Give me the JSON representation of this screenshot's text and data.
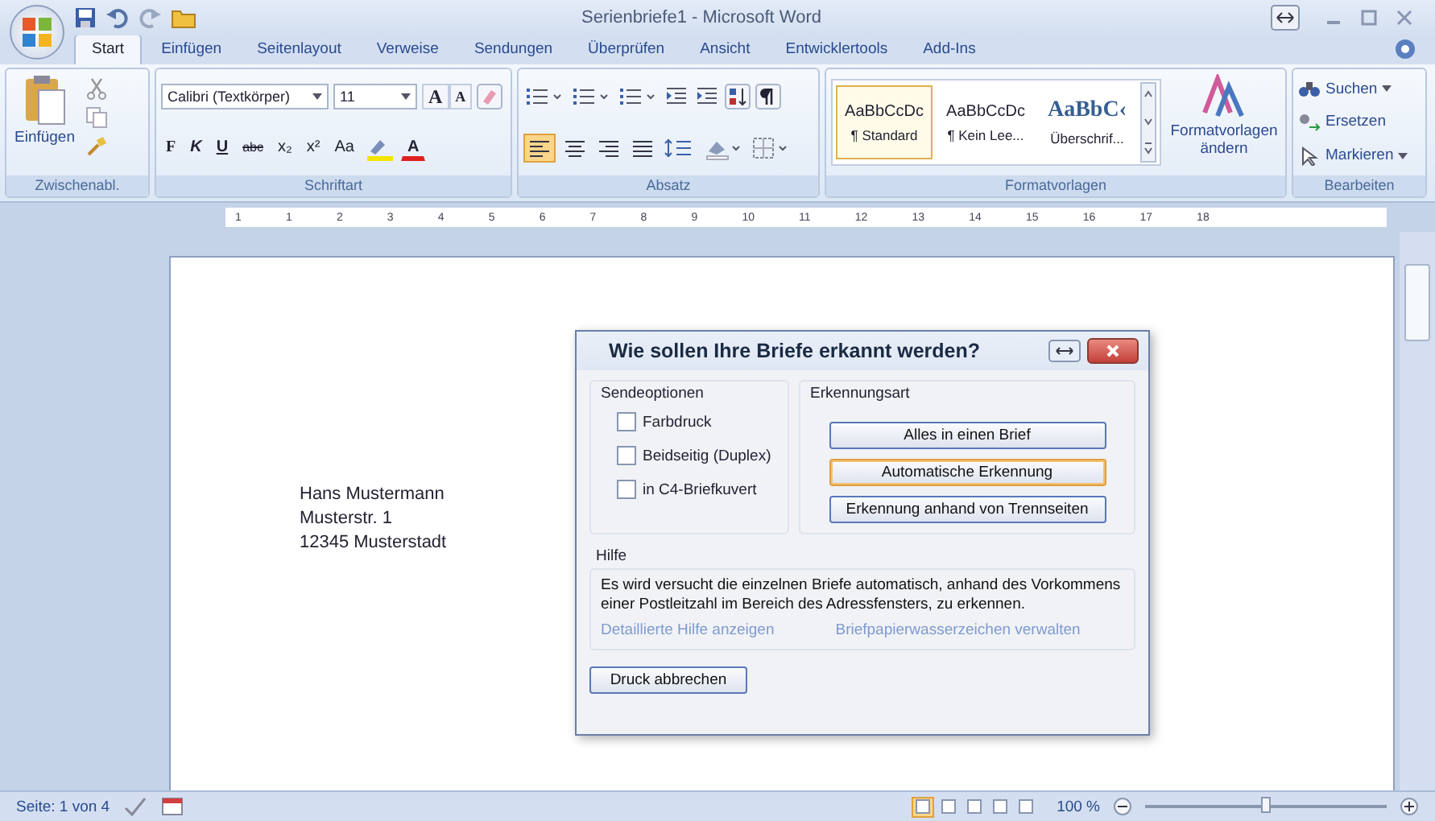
{
  "window": {
    "title": "Serienbriefe1 - Microsoft Word"
  },
  "tabs": [
    {
      "label": "Start",
      "selected": true
    },
    {
      "label": "Einfügen",
      "selected": false
    },
    {
      "label": "Seitenlayout",
      "selected": false
    },
    {
      "label": "Verweise",
      "selected": false
    },
    {
      "label": "Sendungen",
      "selected": false
    },
    {
      "label": "Überprüfen",
      "selected": false
    },
    {
      "label": "Ansicht",
      "selected": false
    },
    {
      "label": "Entwicklertools",
      "selected": false
    },
    {
      "label": "Add-Ins",
      "selected": false
    }
  ],
  "ribbon": {
    "clipboard": {
      "paste_label": "Einfügen",
      "group": "Zwischenabl."
    },
    "font": {
      "family": "Calibri (Textkörper)",
      "size": "11",
      "size_buttons": [
        "A",
        "A"
      ],
      "format_buttons": [
        "F",
        "K",
        "U",
        "abc",
        "x₂",
        "x²",
        "Aa"
      ],
      "color_button": "A",
      "group": "Schriftart"
    },
    "paragraph": {
      "group": "Absatz"
    },
    "styles": {
      "items": [
        {
          "kind": "body",
          "sample": "AaBbCcDc",
          "name": "¶ Standard",
          "selected": true
        },
        {
          "kind": "body",
          "sample": "AaBbCcDc",
          "name": "¶ Kein Lee...",
          "selected": false
        },
        {
          "kind": "heading",
          "sample": "AaBbC‹",
          "name": "Überschrif...",
          "selected": false
        }
      ],
      "change_label": "Formatvorlagen ändern",
      "group": "Formatvorlagen"
    },
    "editing": {
      "items": [
        "Suchen",
        "Ersetzen",
        "Markieren"
      ],
      "group": "Bearbeiten"
    }
  },
  "ruler": {
    "numbers": [
      "1",
      "1",
      "2",
      "3",
      "4",
      "5",
      "6",
      "7",
      "8",
      "9",
      "10",
      "11",
      "12",
      "13",
      "14",
      "15",
      "16",
      "17",
      "18"
    ]
  },
  "document": {
    "address": [
      "Hans Mustermann",
      "Musterstr. 1",
      "12345 Musterstadt"
    ]
  },
  "dialog": {
    "title": "Wie sollen Ihre Briefe erkannt werden?",
    "send_options": {
      "title": "Sendeoptionen",
      "checkboxes": [
        {
          "label": "Farbdruck",
          "checked": false
        },
        {
          "label": "Beidseitig (Duplex)",
          "checked": false
        },
        {
          "label": "in C4-Briefkuvert",
          "checked": false
        }
      ]
    },
    "recognition": {
      "title": "Erkennungsart",
      "buttons": [
        {
          "label": "Alles in einen Brief",
          "selected": false
        },
        {
          "label": "Automatische Erkennung",
          "selected": true
        },
        {
          "label": "Erkennung anhand von Trennseiten",
          "selected": false
        }
      ]
    },
    "help": {
      "title": "Hilfe",
      "text": "Es wird versucht die einzelnen Briefe automatisch, anhand des Vorkommens einer Postleitzahl im Bereich des Adressfensters, zu erkennen.",
      "links": [
        "Detaillierte Hilfe anzeigen",
        "Briefpapierwasserzeichen verwalten"
      ]
    },
    "cancel_button": "Druck abbrechen"
  },
  "status_bar": {
    "page": "Seite: 1 von 4",
    "views": [
      {
        "selected": true
      },
      {
        "selected": false
      },
      {
        "selected": false
      },
      {
        "selected": false
      },
      {
        "selected": false
      }
    ],
    "zoom": "100 %",
    "zoom_slider": {
      "level": 0.5
    }
  }
}
